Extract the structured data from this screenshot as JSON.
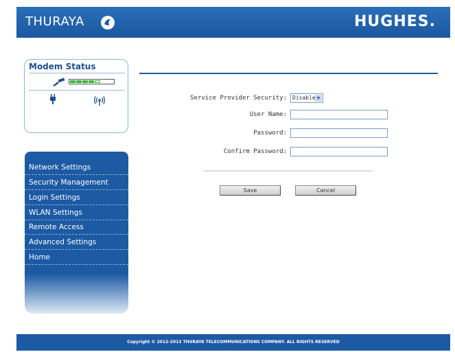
{
  "header": {
    "brand_left": "THURAYA",
    "brand_right": "HUGHES."
  },
  "modem_status": {
    "title": "Modem Status",
    "signal_level_fraction": 0.6
  },
  "sidebar": {
    "items": [
      {
        "label": "Network Settings"
      },
      {
        "label": "Security Management"
      },
      {
        "label": "Login Settings"
      },
      {
        "label": "WLAN Settings"
      },
      {
        "label": "Remote Access"
      },
      {
        "label": "Advanced Settings"
      },
      {
        "label": "Home"
      }
    ]
  },
  "form": {
    "security_label": "Service Provider Security:",
    "security_value": "Disable",
    "username_label": "User Name:",
    "username_value": "",
    "password_label": "Password:",
    "password_value": "",
    "confirm_label": "Confirm Password:",
    "confirm_value": ""
  },
  "buttons": {
    "save_label": "Save",
    "cancel_label": "Cancel"
  },
  "footer": {
    "copyright": "Copyright © 2012-2013 THURAYA TELECOMMUNICATIONS COMPANY. ALL RIGHTS RESERVED"
  },
  "colors": {
    "brand_blue": "#1c5aa3",
    "signal_green": "#3cb43c"
  }
}
